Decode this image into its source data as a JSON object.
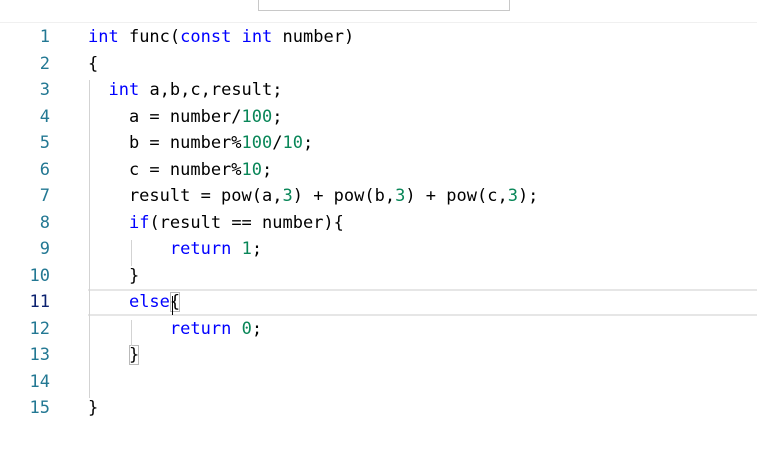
{
  "editor": {
    "lines": [
      {
        "num": "1",
        "tokens": [
          {
            "t": "int",
            "c": "kw"
          },
          {
            "t": " func("
          },
          {
            "t": "const",
            "c": "kw"
          },
          {
            "t": " "
          },
          {
            "t": "int",
            "c": "kw"
          },
          {
            "t": " number)"
          }
        ]
      },
      {
        "num": "2",
        "tokens": [
          {
            "t": "{"
          }
        ]
      },
      {
        "num": "3",
        "tokens": [
          {
            "t": "  "
          },
          {
            "t": "int",
            "c": "kw"
          },
          {
            "t": " a,b,c,result;"
          }
        ]
      },
      {
        "num": "4",
        "tokens": [
          {
            "t": "    a = number/"
          },
          {
            "t": "100",
            "c": "num"
          },
          {
            "t": ";"
          }
        ]
      },
      {
        "num": "5",
        "tokens": [
          {
            "t": "    b = number%"
          },
          {
            "t": "100",
            "c": "num"
          },
          {
            "t": "/"
          },
          {
            "t": "10",
            "c": "num"
          },
          {
            "t": ";"
          }
        ]
      },
      {
        "num": "6",
        "tokens": [
          {
            "t": "    c = number%"
          },
          {
            "t": "10",
            "c": "num"
          },
          {
            "t": ";"
          }
        ]
      },
      {
        "num": "7",
        "tokens": [
          {
            "t": "    result = pow(a,"
          },
          {
            "t": "3",
            "c": "num"
          },
          {
            "t": ") + pow(b,"
          },
          {
            "t": "3",
            "c": "num"
          },
          {
            "t": ") + pow(c,"
          },
          {
            "t": "3",
            "c": "num"
          },
          {
            "t": ");"
          }
        ]
      },
      {
        "num": "8",
        "tokens": [
          {
            "t": "    "
          },
          {
            "t": "if",
            "c": "kw"
          },
          {
            "t": "(result == number){"
          }
        ]
      },
      {
        "num": "9",
        "tokens": [
          {
            "t": "        "
          },
          {
            "t": "return",
            "c": "kw"
          },
          {
            "t": " "
          },
          {
            "t": "1",
            "c": "num"
          },
          {
            "t": ";"
          }
        ]
      },
      {
        "num": "10",
        "tokens": [
          {
            "t": "    }"
          }
        ]
      },
      {
        "num": "11",
        "current": true,
        "tokens": [
          {
            "t": "    "
          },
          {
            "t": "else",
            "c": "kw"
          },
          {
            "t": "{",
            "c": "bm"
          }
        ]
      },
      {
        "num": "12",
        "tokens": [
          {
            "t": "        "
          },
          {
            "t": "return",
            "c": "kw"
          },
          {
            "t": " "
          },
          {
            "t": "0",
            "c": "num"
          },
          {
            "t": ";"
          }
        ]
      },
      {
        "num": "13",
        "tokens": [
          {
            "t": "    "
          },
          {
            "t": "}",
            "c": "bm"
          }
        ]
      },
      {
        "num": "14",
        "tokens": []
      },
      {
        "num": "15",
        "tokens": [
          {
            "t": "}"
          }
        ]
      }
    ]
  },
  "colors": {
    "keyword": "#0000ff",
    "number": "#098658",
    "line_number": "#237893",
    "current_line_number": "#0b216f"
  }
}
